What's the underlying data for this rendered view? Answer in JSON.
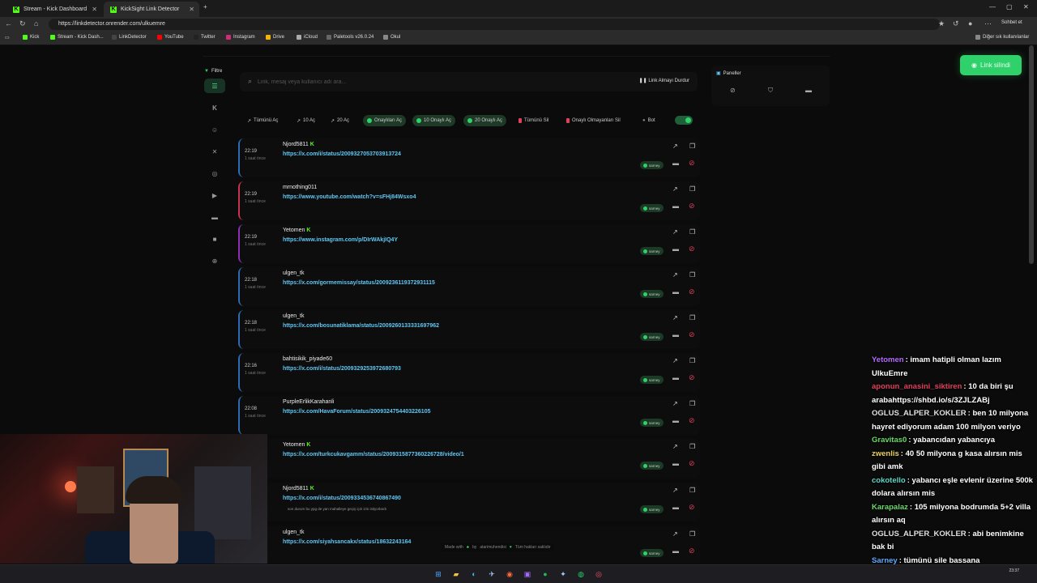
{
  "browser": {
    "tabs": [
      {
        "label": "Stream - Kick Dashboard",
        "active": false
      },
      {
        "label": "KickSight Link Detector",
        "active": true
      }
    ],
    "url": "https://linkdetector.onrender.com/ulkuemre",
    "profile_button": "Sohbet et",
    "bookmarks": [
      {
        "label": "Kick",
        "color": "#53fc18"
      },
      {
        "label": "Stream - Kick Dash...",
        "color": "#53fc18"
      },
      {
        "label": "LinkDetector",
        "color": "#444"
      },
      {
        "label": "YouTube",
        "color": "#ff0000"
      },
      {
        "label": "Twitter",
        "color": "#222"
      },
      {
        "label": "Instagram",
        "color": "#d62976"
      },
      {
        "label": "Drive",
        "color": "#f4b400"
      },
      {
        "label": "iCloud",
        "color": "#aaa"
      },
      {
        "label": "Paletools v26.0.24",
        "color": "#666"
      },
      {
        "label": "Okul",
        "color": "#888"
      }
    ],
    "other_bookmarks": "Diğer sık kullanılanlar"
  },
  "filter": {
    "label": "Filtre",
    "icons": [
      "list-icon",
      "kick-icon",
      "user-icon",
      "x-icon",
      "instagram-icon",
      "youtube-icon",
      "video-icon",
      "camera-icon",
      "globe-icon"
    ]
  },
  "search": {
    "placeholder": "Link, mesaj veya kullanıcı adı ara...",
    "stop_button": "Link Almayı Durdur"
  },
  "actions": [
    {
      "label": "Tümünü Aç",
      "style": "plain"
    },
    {
      "label": "10 Aç",
      "style": "plain"
    },
    {
      "label": "20 Aç",
      "style": "plain"
    },
    {
      "label": "Onaylıları Aç",
      "style": "green"
    },
    {
      "label": "10 Onaylı Aç",
      "style": "green"
    },
    {
      "label": "20 Onaylı Aç",
      "style": "green"
    },
    {
      "label": "Tümünü Sil",
      "style": "red"
    },
    {
      "label": "Onaylı Olmayanları Sil",
      "style": "red"
    },
    {
      "label": "Bot",
      "style": "bot"
    }
  ],
  "panels": {
    "title": "Paneller"
  },
  "toast": {
    "text": "Link silindi"
  },
  "cards": [
    {
      "time": "22:19",
      "ago": "1 saat önce",
      "user": "Njord5811",
      "kick": true,
      "link": "https://x.com/i/status/2009327053703913724",
      "note": "",
      "tag": "sarney",
      "accent": "blue"
    },
    {
      "time": "22:19",
      "ago": "1 saat önce",
      "user": "mrnothing011",
      "kick": false,
      "link": "https://www.youtube.com/watch?v=sFHj84Wsxo4",
      "note": "",
      "tag": "sarney",
      "accent": "red"
    },
    {
      "time": "22:19",
      "ago": "1 saat önce",
      "user": "Yetomen",
      "kick": true,
      "link": "https://www.instagram.com/p/DIrWAkjIQ4Y",
      "note": "",
      "tag": "sarney",
      "accent": "purple"
    },
    {
      "time": "22:18",
      "ago": "1 saat önce",
      "user": "ulgen_tk",
      "kick": false,
      "link": "https://x.com/gormemissay/status/2009236119372931115",
      "note": "",
      "tag": "sarney",
      "accent": "blue"
    },
    {
      "time": "22:18",
      "ago": "1 saat önce",
      "user": "ulgen_tk",
      "kick": false,
      "link": "https://x.com/bosunatiklama/status/2009260133331697962",
      "note": "",
      "tag": "sarney",
      "accent": "blue"
    },
    {
      "time": "22:16",
      "ago": "1 saat önce",
      "user": "bahtisikik_piyade60",
      "kick": false,
      "link": "https://x.com/i/status/2009329253972680793",
      "note": "",
      "tag": "sarney",
      "accent": "blue"
    },
    {
      "time": "22:08",
      "ago": "1 saat önce",
      "user": "PurpleErlikKarahanli",
      "kick": false,
      "link": "https://x.com/HavaForum/status/2009324754403226105",
      "note": "",
      "tag": "sarney",
      "accent": "blue"
    },
    {
      "time": "",
      "ago": "",
      "user": "Yetomen",
      "kick": true,
      "link": "https://x.com/turkcukavgamm/status/2009315877360226728/video/1",
      "note": "",
      "tag": "sarney",
      "accent": "blue"
    },
    {
      "time": "",
      "ago": "",
      "user": "Njord5811",
      "kick": true,
      "link": "https://x.com/i/status/2009334536740867490",
      "note": "son durum bu ypg de yan mahalleye geçiş için izin istiyorlardı",
      "tag": "sarney",
      "accent": "blue"
    },
    {
      "time": "",
      "ago": "",
      "user": "ulgen_tk",
      "kick": false,
      "link": "https://x.com/siyahsancakx/status/18632243164",
      "note": "",
      "tag": "sarney",
      "accent": "blue"
    }
  ],
  "footer": {
    "made_with": "Made with",
    "by": "by",
    "author": "atarimuhendisi",
    "rights": "Tüm hakları saklıdır"
  },
  "chat": [
    {
      "name": "Yetomen",
      "color": "#b36bff",
      "text": "imam hatipli olman lazım UlkuEmre"
    },
    {
      "name": "aponun_anasini_siktiren",
      "color": "#e0405c",
      "text": "10 da biri şu arabahttps://shbd.io/s/3ZJLZABj"
    },
    {
      "name": "OGLUS_ALPER_KOKLER",
      "color": "#e0e0e0",
      "text": "ben 10 milyona hayret ediyorum adam 100 milyon veriyo"
    },
    {
      "name": "Gravitas0",
      "color": "#6bd96b",
      "text": "yabancıdan yabancıya"
    },
    {
      "name": "zwenlis",
      "color": "#e8d25f",
      "text": "40 50 milyona g kasa alırsın mis gibi amk"
    },
    {
      "name": "cokotello",
      "color": "#5fd6c4",
      "text": "yabancı eşle evlenir üzerine 500k dolara alırsın mis"
    },
    {
      "name": "Karapalaz",
      "color": "#6bd96b",
      "text": "105 milyona bodrumda 5+2 villa alırsın aq"
    },
    {
      "name": "OGLUS_ALPER_KOKLER",
      "color": "#e0e0e0",
      "text": "abi benimkine bak bi"
    },
    {
      "name": "Sarney",
      "color": "#5fa8ff",
      "text": "tümünü sile bassana"
    }
  ],
  "clock": {
    "time": "23:37"
  }
}
